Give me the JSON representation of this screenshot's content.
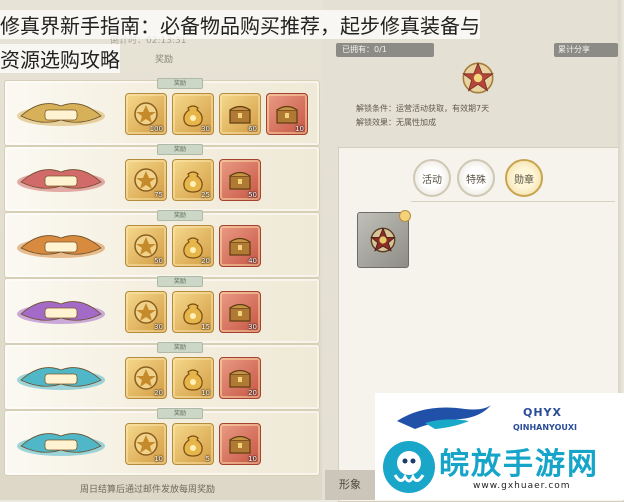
{
  "title": {
    "line1": "修真界新手指南：必备物品购买推荐，起步修真装备与",
    "line2": "资源选购攻略"
  },
  "left": {
    "timer": "倒计时：02:13:31",
    "reward_header": "奖励",
    "row_tab": "奖励",
    "footer": "周日结算后通过邮件发放每周奖励",
    "rows": [
      {
        "rank_color": "#d7b15a",
        "items": [
          {
            "type": "gold",
            "icon": "token-icon",
            "qty": "100"
          },
          {
            "type": "gold",
            "icon": "money-bag-icon",
            "qty": "30"
          },
          {
            "type": "gold",
            "icon": "treasure-chest-icon",
            "qty": "60"
          },
          {
            "type": "red",
            "icon": "treasure-chest-icon",
            "qty": "10"
          }
        ]
      },
      {
        "rank_color": "#d26a6a",
        "items": [
          {
            "type": "gold",
            "icon": "token-icon",
            "qty": "75"
          },
          {
            "type": "gold",
            "icon": "money-bag-icon",
            "qty": "25"
          },
          {
            "type": "red",
            "icon": "treasure-chest-icon",
            "qty": "50"
          }
        ]
      },
      {
        "rank_color": "#d88a3e",
        "items": [
          {
            "type": "gold",
            "icon": "token-icon",
            "qty": "50"
          },
          {
            "type": "gold",
            "icon": "money-bag-icon",
            "qty": "20"
          },
          {
            "type": "red",
            "icon": "treasure-chest-icon",
            "qty": "40"
          }
        ]
      },
      {
        "rank_color": "#a46ac8",
        "items": [
          {
            "type": "gold",
            "icon": "token-icon",
            "qty": "30"
          },
          {
            "type": "gold",
            "icon": "money-bag-icon",
            "qty": "15"
          },
          {
            "type": "red",
            "icon": "treasure-chest-icon",
            "qty": "30"
          }
        ]
      },
      {
        "rank_color": "#4fb7c8",
        "items": [
          {
            "type": "gold",
            "icon": "token-icon",
            "qty": "20"
          },
          {
            "type": "gold",
            "icon": "money-bag-icon",
            "qty": "10"
          },
          {
            "type": "red",
            "icon": "treasure-chest-icon",
            "qty": "20"
          }
        ]
      },
      {
        "rank_color": "#4fb7c8",
        "items": [
          {
            "type": "gold",
            "icon": "token-icon",
            "qty": "10"
          },
          {
            "type": "gold",
            "icon": "money-bag-icon",
            "qty": "5"
          },
          {
            "type": "red",
            "icon": "treasure-chest-icon",
            "qty": "10"
          }
        ]
      }
    ]
  },
  "right": {
    "owned": "已拥有：0/1",
    "cumulative": "累计分享",
    "unlock_condition": "解锁条件：运营活动获取，有效期7天",
    "unlock_effect": "解锁效果：无属性加成",
    "tabs": [
      {
        "label": "活动",
        "active": false
      },
      {
        "label": "特殊",
        "active": false
      },
      {
        "label": "勋章",
        "active": true
      }
    ],
    "bottom_tab": "形象"
  },
  "watermark": {
    "logo_text": "QHYX",
    "logo_sub": "QINHANYOUXI",
    "brand": "皖放手游网",
    "url": "www.gxhuaer.com"
  }
}
